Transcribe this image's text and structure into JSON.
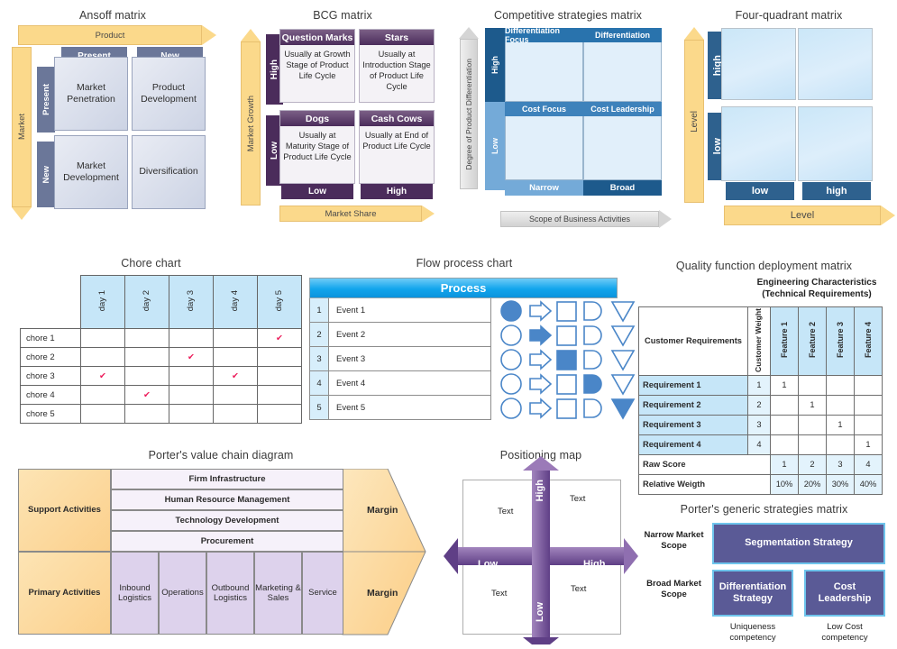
{
  "ansoff": {
    "title": "Ansoff matrix",
    "x_axis_label": "Product",
    "y_axis_label": "Market",
    "col_headers": [
      "Present",
      "New"
    ],
    "row_headers": [
      "Present",
      "New"
    ],
    "cells": [
      [
        "Market Penetration",
        "Product Development"
      ],
      [
        "Market Development",
        "Diversification"
      ]
    ]
  },
  "bcg": {
    "title": "BCG matrix",
    "y_axis_label": "Market Growth",
    "x_axis_label": "Market Share",
    "row_labels": [
      "High",
      "Low"
    ],
    "col_labels": [
      "Low",
      "High"
    ],
    "quadrants": [
      {
        "heading": "Question Marks",
        "body": "Usually at Growth Stage of Product Life Cycle"
      },
      {
        "heading": "Stars",
        "body": "Usually at Introduction Stage of Product Life Cycle"
      },
      {
        "heading": "Dogs",
        "body": "Usually at Maturity Stage of Product Life Cycle"
      },
      {
        "heading": "Cash Cows",
        "body": "Usually at End of Product Life Cycle"
      }
    ]
  },
  "competitive": {
    "title": "Competitive strategies matrix",
    "y_axis_label": "Degree of Product Differentiation",
    "x_axis_label": "Scope of Business Activities",
    "row_labels": [
      "High",
      "Low"
    ],
    "col_labels": [
      "Narrow",
      "Broad"
    ],
    "headers": [
      "Differentiation Focus",
      "Differentiation",
      "Cost Focus",
      "Cost Leadership"
    ]
  },
  "fourquadrant": {
    "title": "Four-quadrant matrix",
    "y_axis_label": "Level",
    "x_axis_label": "Level",
    "row_labels": [
      "high",
      "low"
    ],
    "col_labels": [
      "low",
      "high"
    ]
  },
  "chore": {
    "title": "Chore chart",
    "columns": [
      "day 1",
      "day 2",
      "day 3",
      "day 4",
      "day 5"
    ],
    "rows": [
      "chore 1",
      "chore 2",
      "chore 3",
      "chore 4",
      "chore 5"
    ],
    "check_glyph": "✔",
    "checks": [
      [
        false,
        false,
        false,
        false,
        true
      ],
      [
        false,
        false,
        true,
        false,
        false
      ],
      [
        true,
        false,
        false,
        true,
        false
      ],
      [
        false,
        true,
        false,
        false,
        false
      ],
      [
        false,
        false,
        false,
        false,
        false
      ]
    ],
    "check_color": "#ec1b5a"
  },
  "flow": {
    "title": "Flow process chart",
    "header": "Process",
    "rows": [
      {
        "num": "1",
        "event": "Event 1",
        "filled": 0
      },
      {
        "num": "2",
        "event": "Event 2",
        "filled": 1
      },
      {
        "num": "3",
        "event": "Event 3",
        "filled": 2
      },
      {
        "num": "4",
        "event": "Event 4",
        "filled": 3
      },
      {
        "num": "5",
        "event": "Event 5",
        "filled": 4
      }
    ],
    "shape_names": [
      "operation-circle",
      "transport-arrow",
      "inspection-square",
      "delay-dshape",
      "storage-triangle"
    ],
    "accent": "#4a86c8"
  },
  "qfd": {
    "title": "Quality function deployment matrix",
    "subtitle": "Engineering Characteristics (Technical Requirements)",
    "corner_label": "Customer Requirements",
    "weight_header": "Customer Weight",
    "features": [
      "Feature 1",
      "Feature 2",
      "Feature 3",
      "Feature 4"
    ],
    "requirements": [
      {
        "name": "Requirement 1",
        "weight": "1",
        "values": [
          "1",
          "",
          "",
          ""
        ]
      },
      {
        "name": "Requirement 2",
        "weight": "2",
        "values": [
          "",
          "1",
          "",
          ""
        ]
      },
      {
        "name": "Requirement 3",
        "weight": "3",
        "values": [
          "",
          "",
          "1",
          ""
        ]
      },
      {
        "name": "Requirement 4",
        "weight": "4",
        "values": [
          "",
          "",
          "",
          "1"
        ]
      }
    ],
    "raw_score_label": "Raw Score",
    "raw_scores": [
      "1",
      "2",
      "3",
      "4"
    ],
    "relative_weight_label": "Relative Weigth",
    "relative_weights": [
      "10%",
      "20%",
      "30%",
      "40%"
    ]
  },
  "valuechain": {
    "title": "Porter's value chain diagram",
    "support_label": "Support Activities",
    "primary_label": "Primary Activities",
    "support_rows": [
      "Firm Infrastructure",
      "Human Resource Management",
      "Technology Development",
      "Procurement"
    ],
    "primary_cells": [
      "Inbound Logistics",
      "Operations",
      "Outbound Logistics",
      "Marketing & Sales",
      "Service"
    ],
    "margin_top": "Margin",
    "margin_bottom": "Margin"
  },
  "positioning": {
    "title": "Positioning map",
    "up_label": "High",
    "down_label": "Low",
    "left_label": "Low",
    "right_label": "High",
    "quadrant_texts": [
      "Text",
      "Text",
      "Text",
      "Text"
    ]
  },
  "portergeneric": {
    "title": "Porter's generic strategies matrix",
    "row_labels": [
      "Narrow Market Scope",
      "Broad Market Scope"
    ],
    "col_labels": [
      "Uniqueness competency",
      "Low Cost competency"
    ],
    "boxes": [
      "Segmentation Strategy",
      "Differentiation Strategy",
      "Cost Leadership"
    ],
    "accent": "#5a5a96"
  }
}
